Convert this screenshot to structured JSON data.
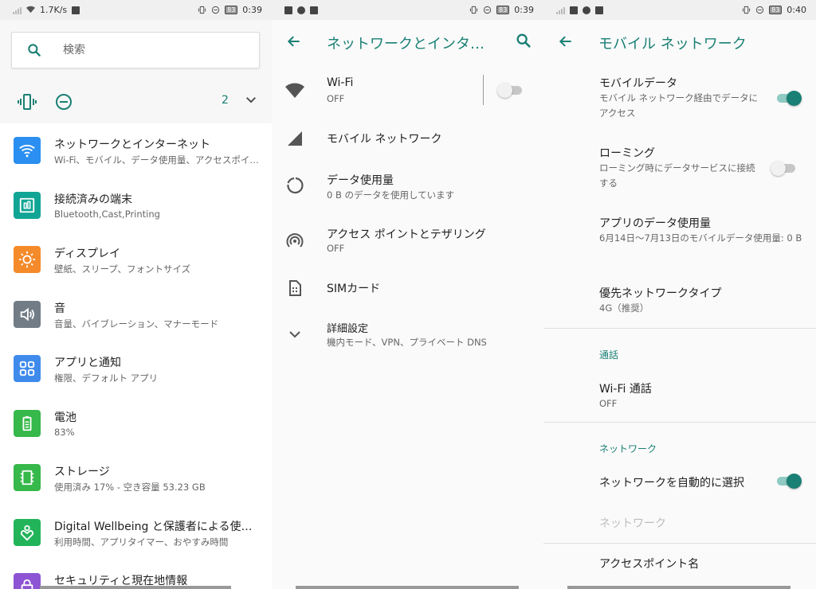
{
  "status": {
    "p1": {
      "speed": "1.7K/s",
      "battery": "83",
      "time": "0:39"
    },
    "p2": {
      "battery": "83",
      "time": "0:39"
    },
    "p3": {
      "battery": "83",
      "time": "0:40"
    }
  },
  "settings_home": {
    "search_placeholder": "検索",
    "conditions_count": "2",
    "items": [
      {
        "title": "ネットワークとインターネット",
        "sub": "Wi-Fi、モバイル、データ使用量、アクセスポイント",
        "icon": "wifi-icon",
        "color": "#2a8ff0"
      },
      {
        "title": "接続済みの端末",
        "sub": "Bluetooth,Cast,Printing",
        "icon": "devices-icon",
        "color": "#10a595"
      },
      {
        "title": "ディスプレイ",
        "sub": "壁紙、スリープ、フォントサイズ",
        "icon": "brightness-icon",
        "color": "#f58a2a"
      },
      {
        "title": "音",
        "sub": "音量、バイブレーション、マナーモード",
        "icon": "volume-icon",
        "color": "#727c86"
      },
      {
        "title": "アプリと通知",
        "sub": "権限、デフォルト アプリ",
        "icon": "apps-icon",
        "color": "#3f8bec"
      },
      {
        "title": "電池",
        "sub": "83%",
        "icon": "battery-icon",
        "color": "#36b84a"
      },
      {
        "title": "ストレージ",
        "sub": "使用済み 17% - 空き容量 53.23 GB",
        "icon": "storage-icon",
        "color": "#36b84a"
      },
      {
        "title": "Digital Wellbeing と保護者による使用制限",
        "sub": "利用時間、アプリタイマー、おやすみ時間",
        "icon": "wellbeing-icon",
        "color": "#23b45a"
      },
      {
        "title": "セキュリティと現在地情報",
        "sub": "",
        "icon": "lock-icon",
        "color": "#8d54d3"
      }
    ]
  },
  "network": {
    "title": "ネットワークとインターネット",
    "wifi": {
      "title": "Wi-Fi",
      "sub": "OFF"
    },
    "mobile": {
      "title": "モバイル ネットワーク"
    },
    "data": {
      "title": "データ使用量",
      "sub": "0 B のデータを使用しています"
    },
    "hotspot": {
      "title": "アクセス ポイントとテザリング",
      "sub": "OFF"
    },
    "sim": {
      "title": "SIMカード"
    },
    "advanced": {
      "title": "詳細設定",
      "sub": "機内モード、VPN、プライベート DNS"
    }
  },
  "mobile_network": {
    "title": "モバイル ネットワーク",
    "mobile_data": {
      "title": "モバイルデータ",
      "sub": "モバイル ネットワーク経由でデータにアクセス"
    },
    "roaming": {
      "title": "ローミング",
      "sub": "ローミング時にデータサービスに接続する"
    },
    "app_data": {
      "title": "アプリのデータ使用量",
      "sub": "6月14日～7月13日のモバイルデータ使用量: 0 B"
    },
    "preferred": {
      "title": "優先ネットワークタイプ",
      "sub": "4G（推奨）"
    },
    "section_calls": "通話",
    "wifi_calling": {
      "title": "Wi-Fi 通話",
      "sub": "OFF"
    },
    "section_network": "ネットワーク",
    "auto_select": {
      "title": "ネットワークを自動的に選択"
    },
    "network_disabled": "ネットワーク",
    "apn": {
      "title": "アクセスポイント名"
    }
  },
  "colors": {
    "accent": "#1a7f74"
  }
}
